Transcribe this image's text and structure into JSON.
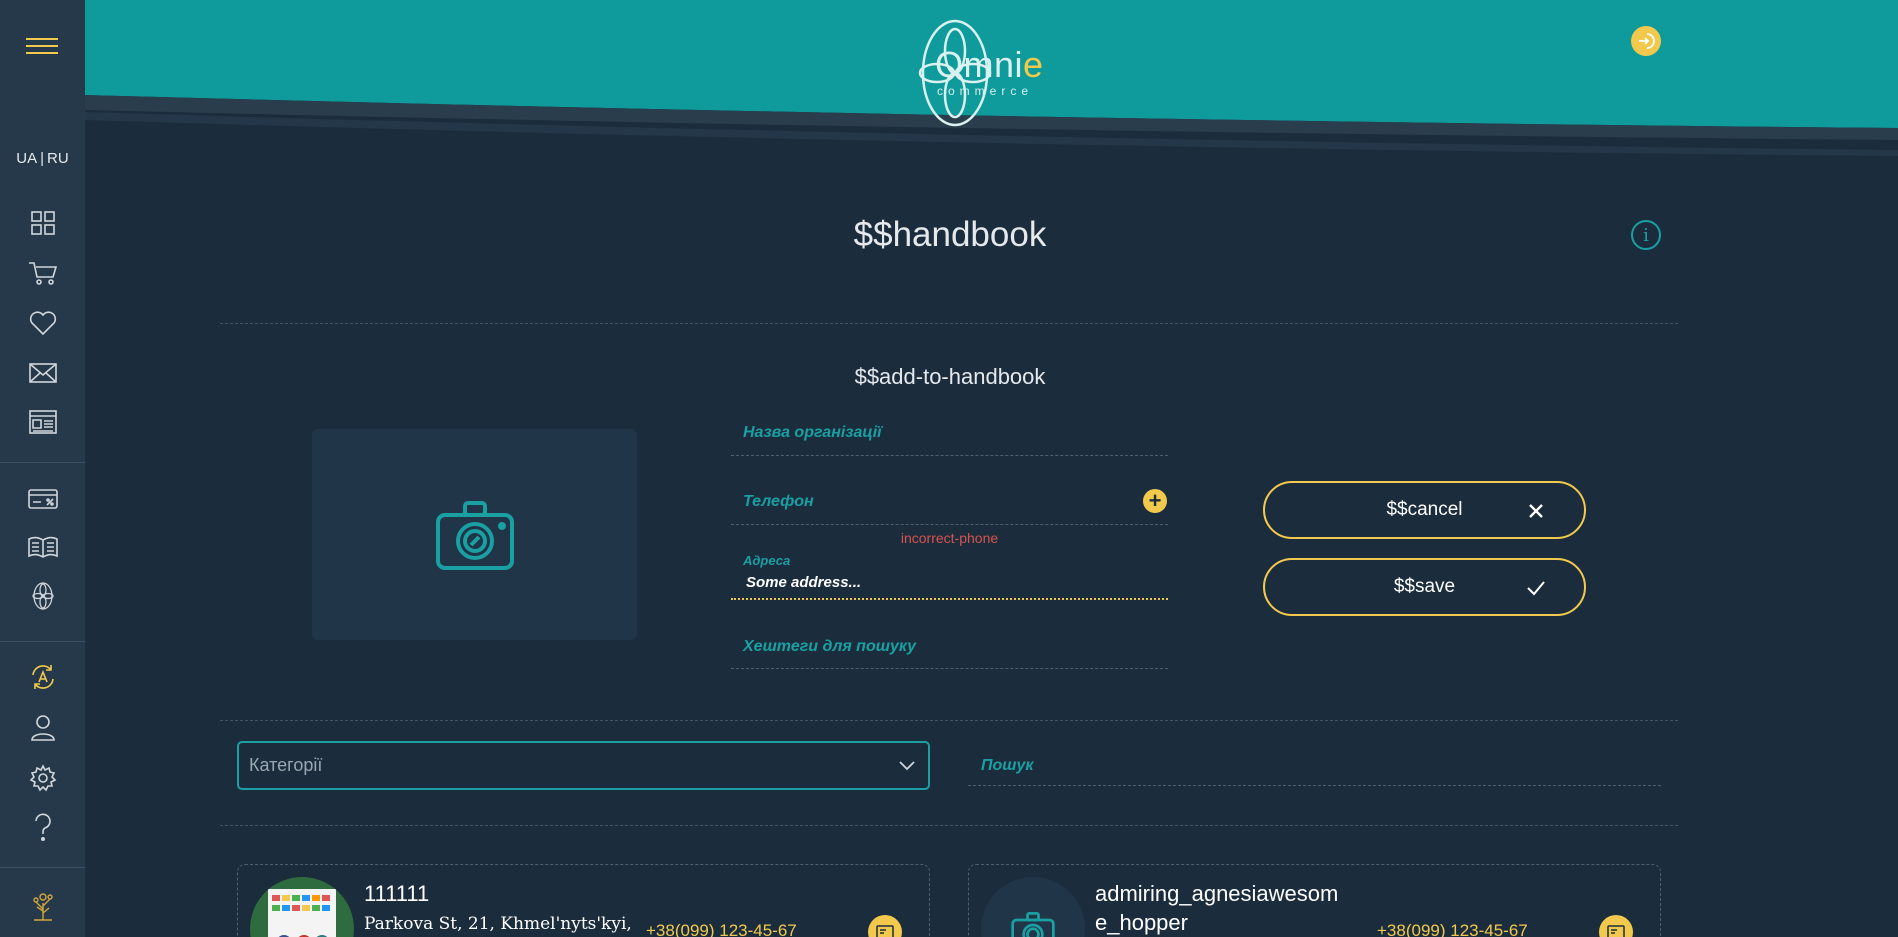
{
  "sidebar": {
    "lang_ua": "UA",
    "lang_ru": "RU",
    "icons": [
      "grid-icon",
      "cart-icon",
      "heart-icon",
      "mail-icon",
      "news-icon",
      "card-discount-icon",
      "book-icon",
      "omnie-flower-icon",
      "auto-exchange-icon",
      "user-icon",
      "gear-icon",
      "help-icon",
      "tree-icon"
    ]
  },
  "header": {
    "logo_text_main": "Omni",
    "logo_text_accent": "e",
    "logo_subtitle": "commerce"
  },
  "main": {
    "title": "$$handbook",
    "section_title": "$$add-to-handbook"
  },
  "form": {
    "org_name_label": "Назва організації",
    "phone_label": "Телефон",
    "phone_error": "incorrect-phone",
    "address_label": "Адреса",
    "address_value": "Some address...",
    "hashtags_label": "Хештеги для пошуку"
  },
  "actions": {
    "cancel_label": "$$cancel",
    "save_label": "$$save"
  },
  "filters": {
    "category_placeholder": "Категорії",
    "search_placeholder": "Пошук"
  },
  "entries": [
    {
      "name": "111111",
      "address": "Parkova St, 21, Khmel'nyts'kyi,",
      "phone": "+38(099) 123-45-67"
    },
    {
      "name_line1": "admiring_agnesiawesom",
      "name_line2": "e_hopper",
      "phone": "+38(099) 123-45-67"
    }
  ],
  "colors": {
    "accent": "#f2c94c",
    "teal": "#1a9fa2",
    "header_bg": "#0f9a9c",
    "page_bg": "#1b2d3d",
    "sidebar_bg": "#26394a",
    "error": "#d9534f"
  }
}
